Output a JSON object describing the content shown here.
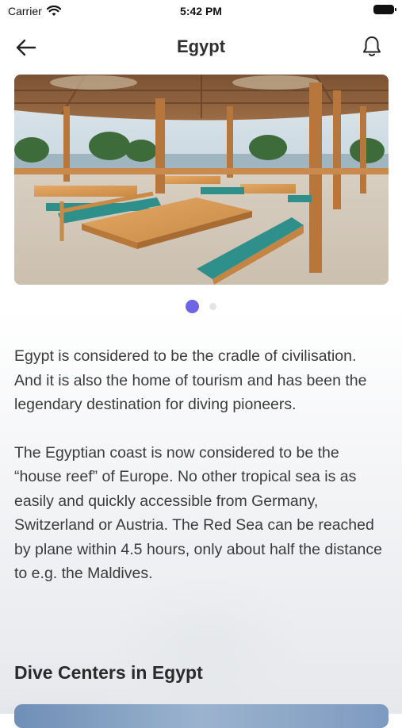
{
  "status_bar": {
    "carrier": "Carrier",
    "time": "5:42 PM",
    "icons": [
      "wifi-icon",
      "battery-icon"
    ]
  },
  "nav": {
    "title": "Egypt",
    "back_icon": "arrow-left-icon",
    "notification_icon": "bell-icon"
  },
  "hero": {
    "image": "restaurant-terrace-photo"
  },
  "pager": {
    "current": 1,
    "total": 2,
    "active_color": "#6f63e6"
  },
  "description": [
    "Egypt is considered to be the cradle of civilisation. And it is also the home of tourism and has been the legendary destination for diving pioneers.",
    "The Egyptian coast is now considered to be the “house reef” of Europe. No other tropical sea is as easily and quickly accessible from Germany, Switzerland or Austria. The Red Sea can be reached by plane within 4.5 hours, only about half the distance to e.g. the Maldives."
  ],
  "section": {
    "title": "Dive Centers in Egypt"
  }
}
